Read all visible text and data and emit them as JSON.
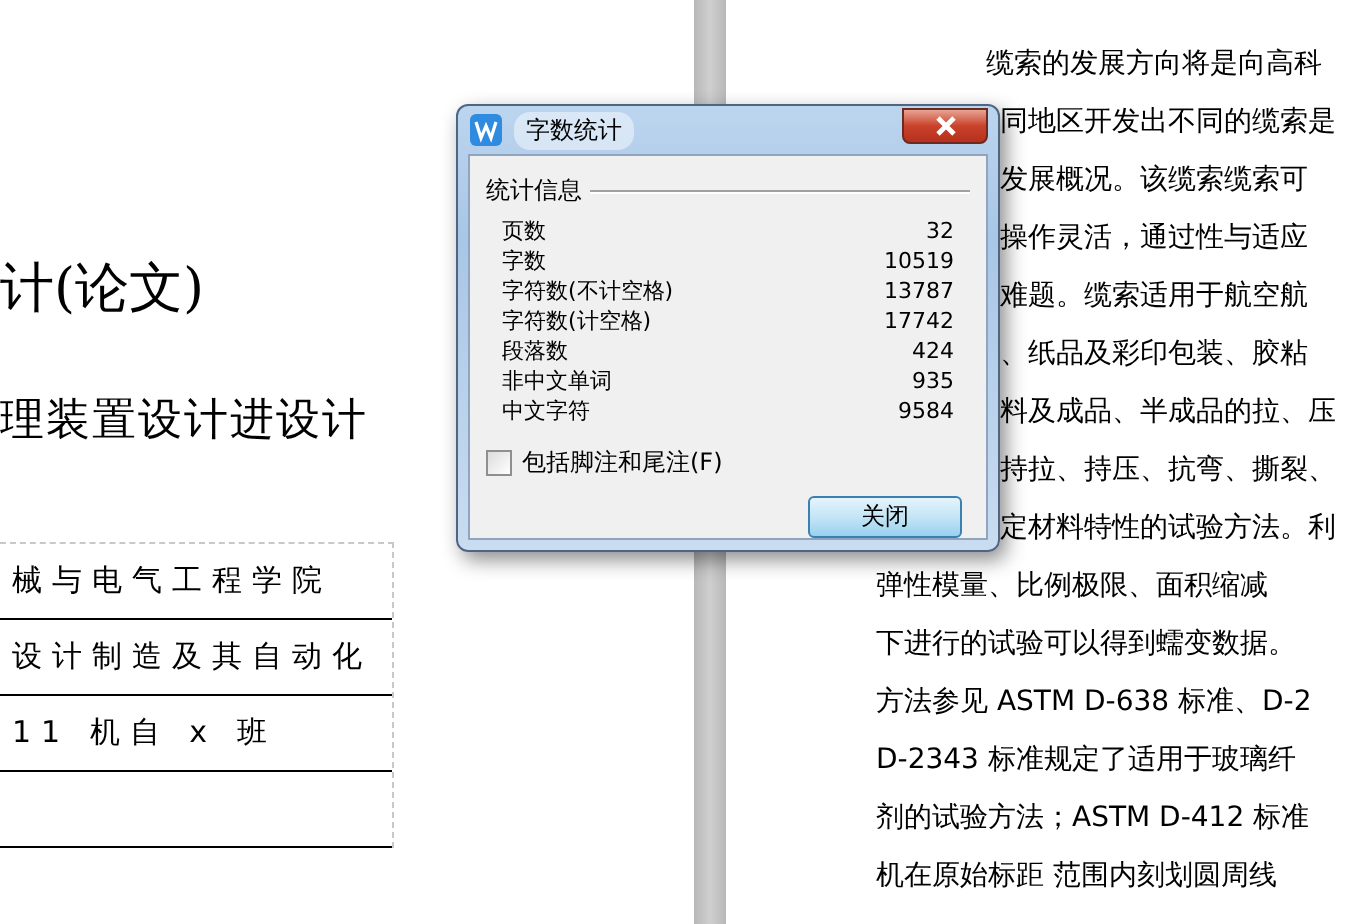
{
  "left_page": {
    "title": "计(论文)",
    "subtitle": "理装置设计进设计",
    "info_rows": [
      "械与电气工程学院",
      "设计制造及其自动化",
      "11 机自 x 班"
    ]
  },
  "right_page": {
    "lines": [
      {
        "kind": "indented",
        "text": "缆索的发展方向将是向高科"
      },
      {
        "kind": "behind_dialog",
        "text": "同地区开发出不同的缆索是"
      },
      {
        "kind": "behind_dialog",
        "text": "发展概况。该缆索缆索可"
      },
      {
        "kind": "behind_dialog",
        "text": "操作灵活，通过性与适应"
      },
      {
        "kind": "behind_dialog",
        "text": "难题。缆索适用于航空航"
      },
      {
        "kind": "behind_dialog",
        "text": "、纸品及彩印包装、胶粘"
      },
      {
        "kind": "behind_dialog",
        "text": "料及成品、半成品的拉、压"
      },
      {
        "kind": "behind_dialog",
        "text": "持拉、持压、抗弯、撕裂、"
      },
      {
        "kind": "behind_dialog",
        "text": "定材料特性的试验方法。利"
      },
      {
        "kind": "plain",
        "text": "弹性模量、比例极限、面积缩减"
      },
      {
        "kind": "plain",
        "text": "下进行的试验可以得到蠕变数据。"
      },
      {
        "kind": "plain",
        "text": "方法参见 ASTM D-638 标准、D-2"
      },
      {
        "kind": "plain",
        "text": "D-2343 标准规定了适用于玻璃纤"
      },
      {
        "kind": "plain",
        "text": "剂的试验方法；ASTM D-412 标准"
      },
      {
        "kind": "plain",
        "text": "机在原始标距 范围内刻划圆周线"
      }
    ]
  },
  "dialog": {
    "title": "字数统计",
    "group_label": "统计信息",
    "stats": [
      {
        "label": "页数",
        "value": "32"
      },
      {
        "label": "字数",
        "value": "10519"
      },
      {
        "label": "字符数(不计空格)",
        "value": "13787"
      },
      {
        "label": "字符数(计空格)",
        "value": "17742"
      },
      {
        "label": "段落数",
        "value": "424"
      },
      {
        "label": "非中文单词",
        "value": "935"
      },
      {
        "label": "中文字符",
        "value": "9584"
      }
    ],
    "checkbox": {
      "label": "包括脚注和尾注(F)",
      "checked": false
    },
    "buttons": [
      "关闭"
    ]
  }
}
